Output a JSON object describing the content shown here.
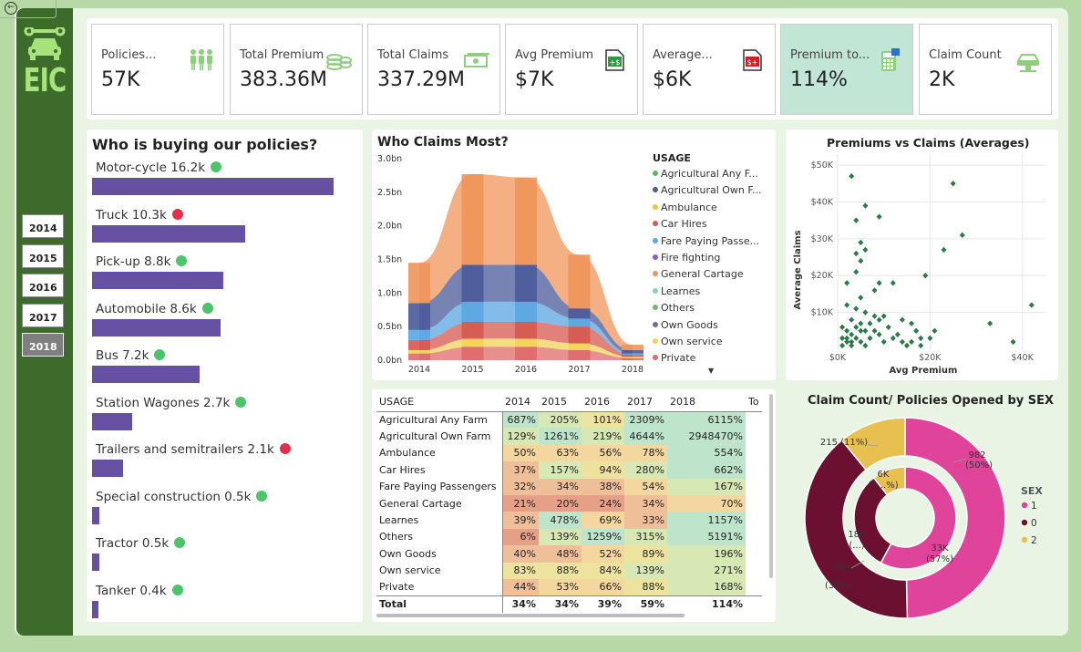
{
  "sidebar": {
    "logo_text": "EIC",
    "back_icon": "back-arrow-icon",
    "years": [
      "2014",
      "2015",
      "2016",
      "2017",
      "2018"
    ],
    "selected_year": "2018"
  },
  "kpis": [
    {
      "label": "Policies...",
      "value": "57K",
      "icon": "people-icon",
      "icon_color": "#8ecf7e"
    },
    {
      "label": "Total Premium",
      "value": "383.36M",
      "icon": "coins-icon",
      "icon_color": "#8ecf7e"
    },
    {
      "label": "Total Claims",
      "value": "337.29M",
      "icon": "cash-icon",
      "icon_color": "#8ecf7e"
    },
    {
      "label": "Avg Premium",
      "value": "$7K",
      "icon": "dollar-plus-icon",
      "icon_color": "#2e9b3e"
    },
    {
      "label": "Average...",
      "value": "$6K",
      "icon": "dollar-minus-icon",
      "icon_color": "#d21f26"
    },
    {
      "label": "Premium to...",
      "value": "114%",
      "icon": "calculator-icon",
      "icon_color": "#8ecf7e",
      "highlight": true
    },
    {
      "label": "Claim Count",
      "value": "2K",
      "icon": "car-lift-icon",
      "icon_color": "#8ecf7e"
    }
  ],
  "buying": {
    "title": "Who is buying our policies?",
    "items": [
      {
        "label": "Motor-cycle 16.2k",
        "value": 16.2,
        "status": "green"
      },
      {
        "label": "Truck 10.3k",
        "value": 10.3,
        "status": "red"
      },
      {
        "label": "Pick-up 8.8k",
        "value": 8.8,
        "status": "green"
      },
      {
        "label": "Automobile 8.6k",
        "value": 8.6,
        "status": "green"
      },
      {
        "label": "Bus 7.2k",
        "value": 7.2,
        "status": "green"
      },
      {
        "label": "Station Wagones 2.7k",
        "value": 2.7,
        "status": "green"
      },
      {
        "label": "Trailers and semitrailers 2.1k",
        "value": 2.1,
        "status": "red"
      },
      {
        "label": "Special construction 0.5k",
        "value": 0.5,
        "status": "green"
      },
      {
        "label": "Tractor 0.5k",
        "value": 0.5,
        "status": "green"
      },
      {
        "label": "Tanker 0.4k",
        "value": 0.4,
        "status": "green"
      }
    ],
    "colors": {
      "bar": "#6650a2",
      "green": "#4cc46a",
      "red": "#e0304b"
    }
  },
  "claims_most": {
    "title": "Who Claims Most?",
    "legend_title": "USAGE",
    "legend": [
      {
        "label": "Agricultural Any F...",
        "color": "#5bb85d"
      },
      {
        "label": "Agricultural Own F...",
        "color": "#4a5a9a"
      },
      {
        "label": "Ambulance",
        "color": "#e6c64a"
      },
      {
        "label": "Car Hires",
        "color": "#d6584f"
      },
      {
        "label": "Fare Paying Passe...",
        "color": "#5aa6e0"
      },
      {
        "label": "Fire fighting",
        "color": "#8a5ec6"
      },
      {
        "label": "General Cartage",
        "color": "#f0955a"
      },
      {
        "label": "Learnes",
        "color": "#7fd3b8"
      },
      {
        "label": "Others",
        "color": "#6dba5e"
      },
      {
        "label": "Own Goods",
        "color": "#6c6f9c"
      },
      {
        "label": "Own service",
        "color": "#f2d25a"
      },
      {
        "label": "Private",
        "color": "#e06a6a"
      }
    ],
    "yticks": [
      "3.0bn",
      "2.5bn",
      "2.0bn",
      "1.5bn",
      "1.0bn",
      "0.5bn",
      "0.0bn"
    ],
    "xticks": [
      "2014",
      "2015",
      "2016",
      "2017",
      "2018"
    ]
  },
  "matrix": {
    "headers": [
      "USAGE",
      "2014",
      "2015",
      "2016",
      "2017",
      "2018",
      "To"
    ],
    "rows": [
      {
        "name": "Agricultural Any Farm",
        "v": [
          "687%",
          "205%",
          "101%",
          "2309%",
          "6115%"
        ]
      },
      {
        "name": "Agricultural Own Farm",
        "v": [
          "129%",
          "1261%",
          "219%",
          "4644%",
          "2948470%"
        ]
      },
      {
        "name": "Ambulance",
        "v": [
          "50%",
          "63%",
          "56%",
          "78%",
          "554%"
        ]
      },
      {
        "name": "Car Hires",
        "v": [
          "37%",
          "157%",
          "94%",
          "280%",
          "662%"
        ]
      },
      {
        "name": "Fare Paying Passengers",
        "v": [
          "32%",
          "34%",
          "38%",
          "54%",
          "167%"
        ]
      },
      {
        "name": "General Cartage",
        "v": [
          "21%",
          "20%",
          "24%",
          "34%",
          "70%"
        ]
      },
      {
        "name": "Learnes",
        "v": [
          "39%",
          "478%",
          "69%",
          "33%",
          "1157%"
        ]
      },
      {
        "name": "Others",
        "v": [
          "6%",
          "139%",
          "1259%",
          "315%",
          "5191%"
        ]
      },
      {
        "name": "Own Goods",
        "v": [
          "40%",
          "48%",
          "52%",
          "89%",
          "196%"
        ]
      },
      {
        "name": "Own service",
        "v": [
          "83%",
          "88%",
          "84%",
          "139%",
          "271%"
        ]
      },
      {
        "name": "Private",
        "v": [
          "44%",
          "53%",
          "66%",
          "88%",
          "168%"
        ]
      }
    ],
    "total": {
      "name": "Total",
      "v": [
        "34%",
        "34%",
        "39%",
        "59%",
        "114%"
      ]
    }
  },
  "scatter": {
    "title": "Premiums vs Claims (Averages)",
    "xlabel": "Avg Premium",
    "ylabel": "Average Claims",
    "xticks": [
      "$0K",
      "$20K",
      "$40K"
    ],
    "yticks": [
      "$50K",
      "$40K",
      "$30K",
      "$20K",
      "$10K"
    ],
    "color": "#2a7a4a"
  },
  "donut": {
    "title": "Claim Count/ Policies Opened by SEX",
    "legend_title": "SEX",
    "legend": [
      {
        "label": "1",
        "color": "#e0439a"
      },
      {
        "label": "0",
        "color": "#6b1030"
      },
      {
        "label": "2",
        "color": "#e8c050"
      }
    ],
    "outer_labels": [
      "982",
      "(50%)",
      "781",
      "(39%)",
      "215 (11%)"
    ],
    "inner_labels": [
      "33K",
      "(57%)",
      "18K",
      "(...)",
      "6K",
      "(1...%)"
    ]
  },
  "chart_data": [
    {
      "type": "bar",
      "title": "Who is buying our policies?",
      "categories": [
        "Motor-cycle",
        "Truck",
        "Pick-up",
        "Automobile",
        "Bus",
        "Station Wagones",
        "Trailers and semitrailers",
        "Special construction",
        "Tractor",
        "Tanker"
      ],
      "values": [
        16.2,
        10.3,
        8.8,
        8.6,
        7.2,
        2.7,
        2.1,
        0.5,
        0.5,
        0.4
      ]
    },
    {
      "type": "area",
      "title": "Who Claims Most?",
      "x": [
        "2014",
        "2015",
        "2016",
        "2017",
        "2018"
      ],
      "ylim": [
        0,
        3.0
      ],
      "series": [
        {
          "name": "Private",
          "values": [
            0.1,
            0.2,
            0.2,
            0.15,
            0.03
          ]
        },
        {
          "name": "Own service",
          "values": [
            0.05,
            0.12,
            0.12,
            0.1,
            0.02
          ]
        },
        {
          "name": "Car Hires",
          "values": [
            0.15,
            0.25,
            0.25,
            0.25,
            0.03
          ]
        },
        {
          "name": "Fare Paying Passe...",
          "values": [
            0.15,
            0.3,
            0.3,
            0.12,
            0.02
          ]
        },
        {
          "name": "Agricultural Own F...",
          "values": [
            0.4,
            0.55,
            0.55,
            0.15,
            0.05
          ]
        },
        {
          "name": "General Cartage",
          "values": [
            0.6,
            1.35,
            1.3,
            0.8,
            0.08
          ]
        }
      ]
    },
    {
      "type": "scatter",
      "title": "Premiums vs Claims (Averages)",
      "xlabel": "Avg Premium",
      "ylabel": "Average Claims",
      "xlim": [
        0,
        45
      ],
      "ylim": [
        0,
        53
      ],
      "points": [
        [
          3,
          47
        ],
        [
          25,
          45
        ],
        [
          6,
          39
        ],
        [
          9,
          36
        ],
        [
          4,
          35
        ],
        [
          27,
          31
        ],
        [
          5,
          29
        ],
        [
          6,
          27
        ],
        [
          4,
          26
        ],
        [
          5,
          24
        ],
        [
          23,
          27
        ],
        [
          19,
          20
        ],
        [
          4,
          21
        ],
        [
          2,
          18
        ],
        [
          12,
          18
        ],
        [
          9,
          18
        ],
        [
          42,
          12
        ],
        [
          8,
          16
        ],
        [
          5,
          14
        ],
        [
          33,
          7
        ],
        [
          38,
          2
        ],
        [
          2,
          12
        ],
        [
          4,
          11
        ],
        [
          6,
          10
        ],
        [
          8,
          9
        ],
        [
          3,
          8
        ],
        [
          5,
          7
        ],
        [
          1,
          6
        ],
        [
          2,
          5
        ],
        [
          3,
          4
        ],
        [
          4,
          3
        ],
        [
          5,
          2
        ],
        [
          6,
          1
        ],
        [
          7,
          3
        ],
        [
          8,
          5
        ],
        [
          9,
          4
        ],
        [
          10,
          2
        ],
        [
          11,
          6
        ],
        [
          13,
          4
        ],
        [
          14,
          2
        ],
        [
          16,
          7
        ],
        [
          17,
          5
        ],
        [
          18,
          3
        ],
        [
          15,
          1
        ],
        [
          20,
          3
        ],
        [
          21,
          5
        ],
        [
          2,
          2
        ],
        [
          3,
          1
        ],
        [
          1,
          1
        ],
        [
          2,
          3
        ],
        [
          4,
          6
        ],
        [
          6,
          5
        ],
        [
          7,
          7
        ],
        [
          9,
          8
        ],
        [
          10,
          9
        ],
        [
          12,
          3
        ],
        [
          14,
          8
        ],
        [
          16,
          2
        ],
        [
          18,
          1
        ],
        [
          1,
          3
        ],
        [
          3,
          2
        ],
        [
          5,
          5
        ]
      ]
    },
    {
      "type": "pie",
      "title": "Claim Count/ Policies Opened by SEX",
      "series": [
        {
          "name": "Claim Count",
          "labels": [
            "1",
            "0",
            "2"
          ],
          "values": [
            982,
            781,
            215
          ]
        },
        {
          "name": "Policies Opened",
          "labels": [
            "1",
            "0",
            "2"
          ],
          "values": [
            33,
            18,
            6
          ]
        }
      ]
    }
  ]
}
